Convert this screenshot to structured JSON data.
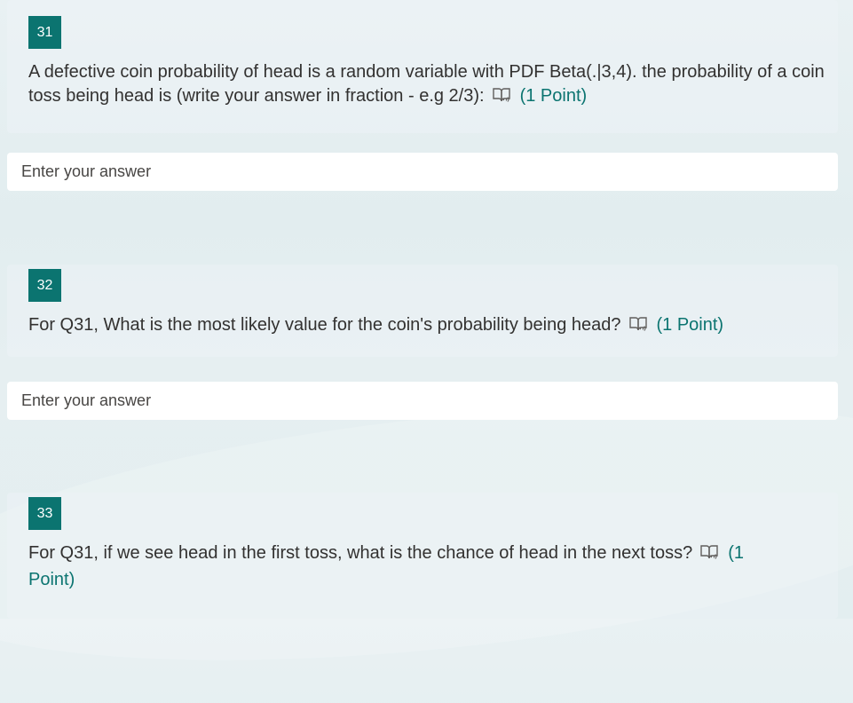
{
  "questions": [
    {
      "number": "31",
      "text": "A defective coin probability of head is a random variable with PDF Beta(.|3,4). the probability of a coin toss being head is (write your answer in fraction - e.g 2/3):",
      "points": "(1 Point)",
      "answer_placeholder": "Enter your answer"
    },
    {
      "number": "32",
      "text": "For Q31, What is the most likely value for the coin's probability being head?",
      "points": "(1 Point)",
      "answer_placeholder": "Enter your answer"
    },
    {
      "number": "33",
      "text": "For Q31, if we see head in the first toss, what is the chance of head in the next toss?",
      "points": "(1 Point)"
    }
  ],
  "icons": {
    "reader": "immersive-reader-icon"
  },
  "colors": {
    "accent": "#0b7470",
    "text": "#323130",
    "input_bg": "#ffffff"
  }
}
